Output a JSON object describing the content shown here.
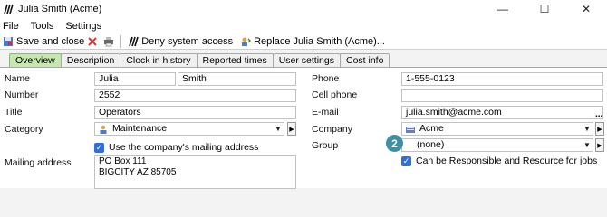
{
  "window": {
    "title": "Julia Smith (Acme)",
    "controls": {
      "minimize": "—",
      "maximize": "☐",
      "close": "✕"
    }
  },
  "menu": [
    "File",
    "Tools",
    "Settings"
  ],
  "toolbar": {
    "save_close": "Save and close",
    "deny_access": "Deny system access",
    "replace": "Replace Julia Smith (Acme)..."
  },
  "tabs": [
    "Overview",
    "Description",
    "Clock in history",
    "Reported times",
    "User settings",
    "Cost info"
  ],
  "form": {
    "name_label": "Name",
    "first_name": "Julia",
    "last_name": "Smith",
    "number_label": "Number",
    "number": "2552",
    "title_label": "Title",
    "title": "Operators",
    "category_label": "Category",
    "category": "Maintenance",
    "use_company_address": "Use the company's mailing address",
    "mailing_label": "Mailing address",
    "mailing_lines": [
      "PO Box 111",
      "BIGCITY AZ 85705"
    ],
    "phone_label": "Phone",
    "phone": "1-555-0123",
    "cell_label": "Cell phone",
    "cell": "",
    "email_label": "E-mail",
    "email": "julia.smith@acme.com",
    "email_more": "...",
    "company_label": "Company",
    "company": "Acme",
    "group_label": "Group",
    "group": "(none)",
    "responsible_resource": "Can be Responsible and Resource for jobs"
  },
  "callout_badge": "2",
  "colors": {
    "active_tab": "#c6e7b0",
    "checkbox": "#2f6fd6",
    "badge": "#3f8fa0"
  }
}
